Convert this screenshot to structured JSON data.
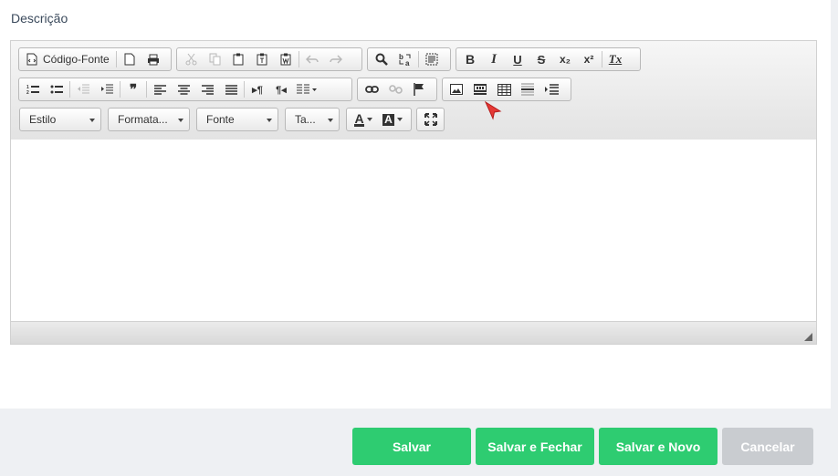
{
  "field": {
    "label": "Descrição"
  },
  "toolbar": {
    "source_label": "Código-Fonte",
    "style_label": "Estilo",
    "format_label": "Formata...",
    "font_label": "Fonte",
    "size_label": "Ta...",
    "text_color": "A",
    "bg_color": "A",
    "bold": "B",
    "italic": "I",
    "underline": "U",
    "strike": "S",
    "subscript": "x₂",
    "superscript": "x²",
    "removeformat": "Tx",
    "blockquote": "❞",
    "ltr": "▸¶",
    "rtl": "¶◂"
  },
  "footer": {
    "save": "Salvar",
    "save_close": "Salvar e Fechar",
    "save_new": "Salvar e Novo",
    "cancel": "Cancelar"
  },
  "colors": {
    "primary": "#2ecc71",
    "cancel": "#c9ccd0",
    "label": "#3b4a5c"
  }
}
